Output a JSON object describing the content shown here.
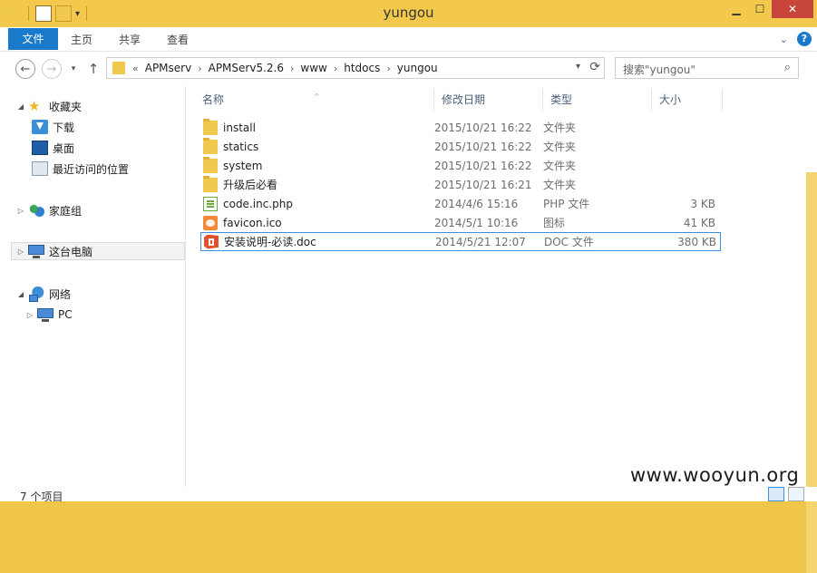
{
  "window": {
    "title": "yungou"
  },
  "ribbon": {
    "tabs": [
      "文件",
      "主页",
      "共享",
      "查看"
    ]
  },
  "address": {
    "prefix": "«",
    "crumbs": [
      "APMserv",
      "APMServ5.2.6",
      "www",
      "htdocs",
      "yungou"
    ]
  },
  "search": {
    "placeholder": "搜索\"yungou\""
  },
  "nav_pane": {
    "favorites": "收藏夹",
    "downloads": "下载",
    "desktop": "桌面",
    "recent": "最近访问的位置",
    "homegroup": "家庭组",
    "this_pc": "这台电脑",
    "network": "网络",
    "pc": "PC"
  },
  "columns": {
    "name": "名称",
    "modified": "修改日期",
    "type": "类型",
    "size": "大小"
  },
  "files": [
    {
      "name": "install",
      "modified": "2015/10/21 16:22",
      "type": "文件夹",
      "size": "",
      "icon": "folder-icon"
    },
    {
      "name": "statics",
      "modified": "2015/10/21 16:22",
      "type": "文件夹",
      "size": "",
      "icon": "folder-icon"
    },
    {
      "name": "system",
      "modified": "2015/10/21 16:22",
      "type": "文件夹",
      "size": "",
      "icon": "folder-icon"
    },
    {
      "name": "升级后必看",
      "modified": "2015/10/21 16:21",
      "type": "文件夹",
      "size": "",
      "icon": "folder-icon"
    },
    {
      "name": "code.inc.php",
      "modified": "2014/4/6 15:16",
      "type": "PHP 文件",
      "size": "3 KB",
      "icon": "php-file-icon"
    },
    {
      "name": "favicon.ico",
      "modified": "2014/5/1 10:16",
      "type": "图标",
      "size": "41 KB",
      "icon": "ico-file-icon"
    },
    {
      "name": "安装说明-必读.doc",
      "modified": "2014/5/21 12:07",
      "type": "DOC 文件",
      "size": "380 KB",
      "icon": "office-doc-icon"
    }
  ],
  "status": {
    "count": "7 个项目"
  },
  "watermark": "www.wooyun.org",
  "colors": {
    "titlebar": "#f2c84d",
    "accent": "#1979ca",
    "close": "#c7453a",
    "selection_border": "#3d8fe0"
  }
}
